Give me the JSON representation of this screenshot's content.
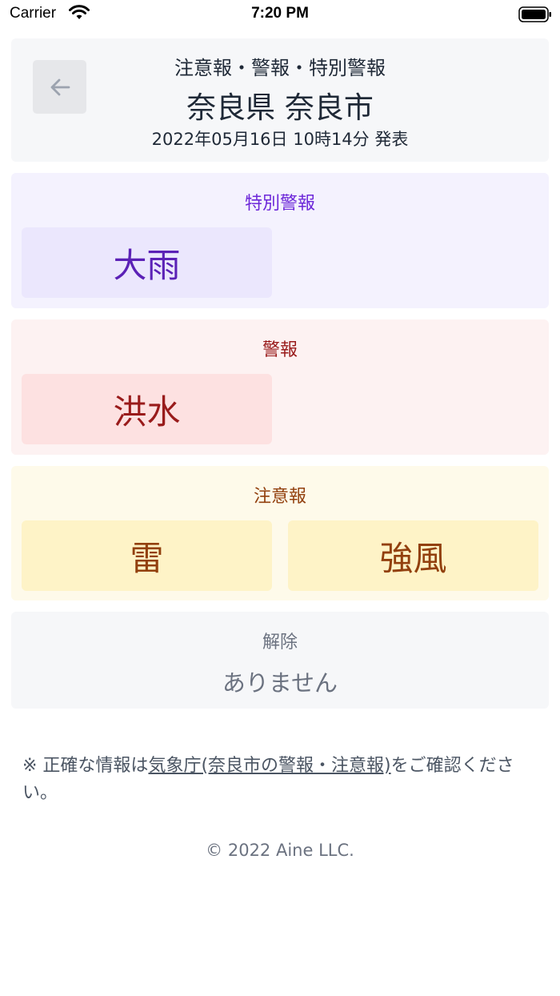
{
  "status_bar": {
    "carrier": "Carrier",
    "time": "7:20 PM"
  },
  "header": {
    "subtitle": "注意報・警報・特別警報",
    "title": "奈良県 奈良市",
    "issued": "2022年05月16日 10時14分 発表"
  },
  "special_warning": {
    "label": "特別警報",
    "items": [
      "大雨"
    ]
  },
  "warning": {
    "label": "警報",
    "items": [
      "洪水"
    ]
  },
  "advisory": {
    "label": "注意報",
    "items": [
      "雷",
      "強風"
    ]
  },
  "cleared": {
    "label": "解除",
    "text": "ありません"
  },
  "note": {
    "prefix": "※ 正確な情報は",
    "link": "気象庁(奈良市の警報・注意報)",
    "suffix": "をご確認ください。"
  },
  "footer": {
    "copyright": "© 2022 Aine LLC."
  },
  "colors": {
    "special": "#5b21b6",
    "warning": "#991b1b",
    "advisory": "#92400e"
  }
}
